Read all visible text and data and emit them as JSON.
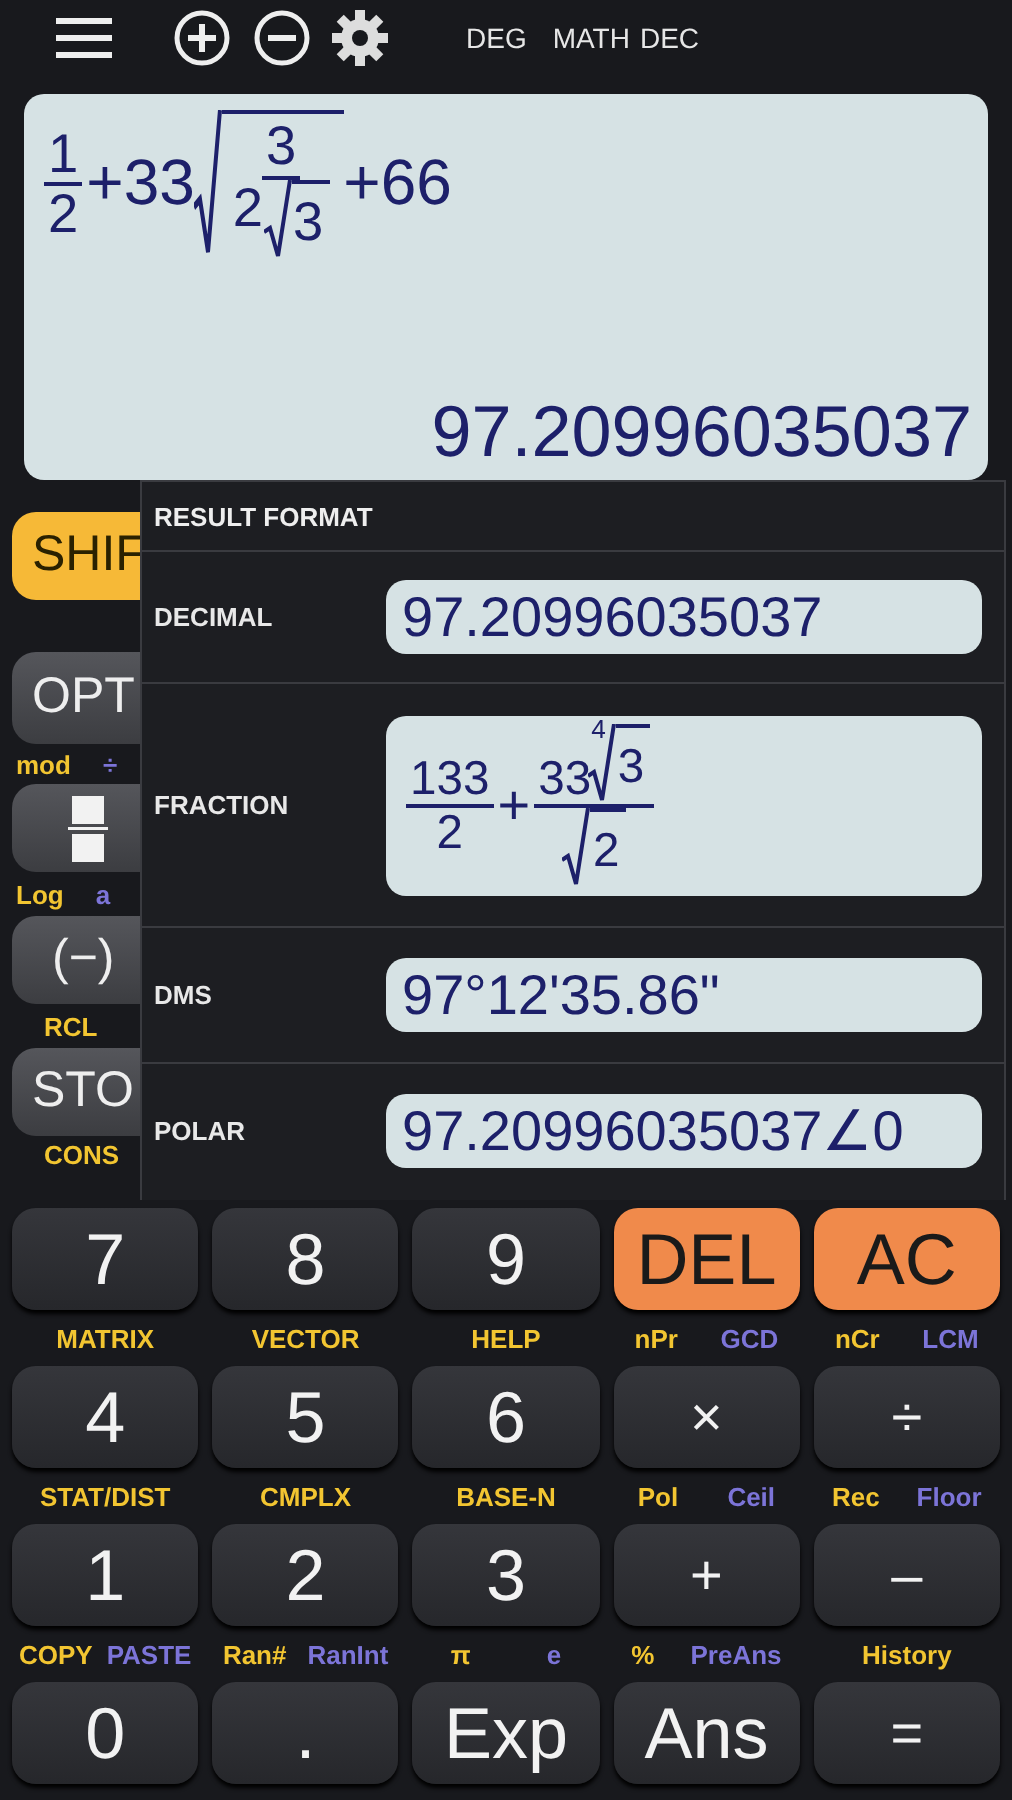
{
  "mode_indicators": [
    "DEG",
    "MATH",
    "DEC"
  ],
  "display": {
    "expression": [
      {
        "kind": "frac",
        "num": [
          {
            "kind": "text",
            "text": "1"
          }
        ],
        "den": [
          {
            "kind": "text",
            "text": "2"
          }
        ]
      },
      {
        "kind": "text",
        "text": "+33"
      },
      {
        "kind": "sqrt",
        "body": [
          {
            "kind": "frac",
            "num": [
              {
                "kind": "text",
                "text": "3"
              }
            ],
            "den": [
              {
                "kind": "text",
                "text": "2"
              },
              {
                "kind": "sqrt",
                "body": [
                  {
                    "kind": "text",
                    "text": "3"
                  }
                ]
              }
            ]
          }
        ]
      },
      {
        "kind": "text",
        "text": "+66"
      }
    ],
    "result": "97.20996035037"
  },
  "side_keys": [
    {
      "kind": "shift",
      "label": "SHIF"
    },
    {
      "kind": "dark",
      "label": "OPT",
      "sublabels": [
        {
          "kind": "shift",
          "text": "mod"
        },
        {
          "kind": "alpha",
          "text": "÷"
        }
      ]
    },
    {
      "kind": "fraction",
      "sublabels": [
        {
          "kind": "shift",
          "text": "Log"
        },
        {
          "kind": "alpha",
          "text": "a"
        }
      ]
    },
    {
      "kind": "dark",
      "label": "(−)",
      "sublabels": [
        {
          "kind": "shift",
          "text": "RCL"
        }
      ]
    },
    {
      "kind": "dark",
      "label": "STO",
      "sublabels": [
        {
          "kind": "shift",
          "text": "CONS"
        }
      ]
    }
  ],
  "result_format": {
    "title": "RESULT FORMAT",
    "options": [
      {
        "label": "DECIMAL",
        "value": [
          {
            "kind": "text",
            "text": "97.20996035037"
          }
        ]
      },
      {
        "label": "FRACTION",
        "value": [
          {
            "kind": "frac",
            "num": [
              {
                "kind": "text",
                "text": "133"
              }
            ],
            "den": [
              {
                "kind": "text",
                "text": "2"
              }
            ]
          },
          {
            "kind": "text",
            "text": "+"
          },
          {
            "kind": "frac",
            "num": [
              {
                "kind": "text",
                "text": "33"
              },
              {
                "kind": "sqrt",
                "index": "4",
                "body": [
                  {
                    "kind": "text",
                    "text": "3"
                  }
                ]
              }
            ],
            "den": [
              {
                "kind": "sqrt",
                "body": [
                  {
                    "kind": "text",
                    "text": "2"
                  }
                ]
              }
            ]
          }
        ]
      },
      {
        "label": "DMS",
        "value": [
          {
            "kind": "text",
            "text": "97°12'35.86\""
          }
        ]
      },
      {
        "label": "POLAR",
        "value": [
          {
            "kind": "text",
            "text": "97.20996035037∠0"
          }
        ]
      }
    ]
  },
  "keypad": [
    {
      "keys": [
        {
          "label": "7",
          "kind": "dark",
          "sublabels": [
            {
              "kind": "shift",
              "text": "MATRIX"
            }
          ]
        },
        {
          "label": "8",
          "kind": "dark",
          "sublabels": [
            {
              "kind": "shift",
              "text": "VECTOR"
            }
          ]
        },
        {
          "label": "9",
          "kind": "dark",
          "sublabels": [
            {
              "kind": "shift",
              "text": "HELP"
            }
          ]
        },
        {
          "label": "DEL",
          "kind": "orange",
          "sublabels": [
            {
              "kind": "shift",
              "text": "nPr"
            },
            {
              "kind": "alpha",
              "text": "GCD"
            }
          ]
        },
        {
          "label": "AC",
          "kind": "orange",
          "sublabels": [
            {
              "kind": "shift",
              "text": "nCr"
            },
            {
              "kind": "alpha",
              "text": "LCM"
            }
          ]
        }
      ]
    },
    {
      "keys": [
        {
          "label": "4",
          "kind": "dark",
          "sublabels": [
            {
              "kind": "shift",
              "text": "STAT/DIST"
            }
          ]
        },
        {
          "label": "5",
          "kind": "dark",
          "sublabels": [
            {
              "kind": "shift",
              "text": "CMPLX"
            }
          ]
        },
        {
          "label": "6",
          "kind": "dark",
          "sublabels": [
            {
              "kind": "shift",
              "text": "BASE-N"
            }
          ]
        },
        {
          "label": "×",
          "kind": "op",
          "sublabels": [
            {
              "kind": "shift",
              "text": "Pol"
            },
            {
              "kind": "alpha",
              "text": "Ceil"
            }
          ]
        },
        {
          "label": "÷",
          "kind": "op",
          "sublabels": [
            {
              "kind": "shift",
              "text": "Rec"
            },
            {
              "kind": "alpha",
              "text": "Floor"
            }
          ]
        }
      ]
    },
    {
      "keys": [
        {
          "label": "1",
          "kind": "dark",
          "sublabels": [
            {
              "kind": "shift",
              "text": "COPY"
            },
            {
              "kind": "alpha",
              "text": "PASTE"
            }
          ]
        },
        {
          "label": "2",
          "kind": "dark",
          "sublabels": [
            {
              "kind": "shift",
              "text": "Ran#"
            },
            {
              "kind": "alpha",
              "text": "RanInt"
            }
          ]
        },
        {
          "label": "3",
          "kind": "dark",
          "sublabels": [
            {
              "kind": "shift",
              "text": "π"
            },
            {
              "kind": "alpha",
              "text": "e"
            }
          ]
        },
        {
          "label": "+",
          "kind": "op",
          "sublabels": [
            {
              "kind": "shift",
              "text": "%"
            },
            {
              "kind": "alpha",
              "text": "PreAns"
            }
          ]
        },
        {
          "label": "–",
          "kind": "op",
          "sublabels": [
            {
              "kind": "shift",
              "text": "History"
            }
          ]
        }
      ]
    },
    {
      "keys": [
        {
          "label": "0",
          "kind": "dark"
        },
        {
          "label": ".",
          "kind": "dark"
        },
        {
          "label": "Exp",
          "kind": "dark"
        },
        {
          "label": "Ans",
          "kind": "dark"
        },
        {
          "label": "=",
          "kind": "op"
        }
      ]
    }
  ]
}
